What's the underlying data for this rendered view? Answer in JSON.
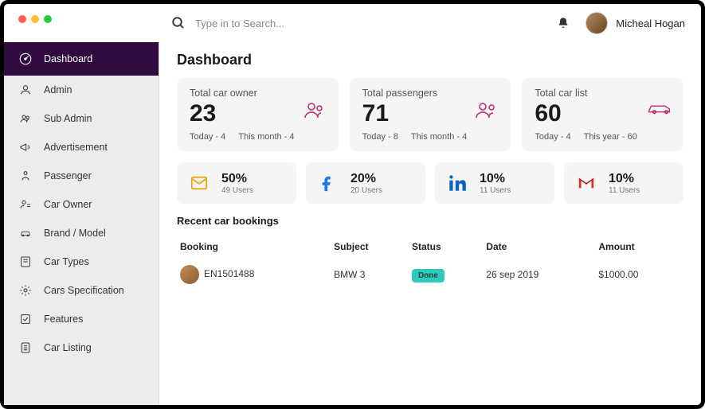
{
  "header": {
    "search_placeholder": "Type in to Search...",
    "username": "Micheal Hogan"
  },
  "sidebar": {
    "items": [
      {
        "label": "Dashboard",
        "icon": "dashboard-icon",
        "active": true
      },
      {
        "label": "Admin",
        "icon": "user-icon"
      },
      {
        "label": "Sub Admin",
        "icon": "users-icon"
      },
      {
        "label": "Advertisement",
        "icon": "megaphone-icon"
      },
      {
        "label": "Passenger",
        "icon": "passenger-icon"
      },
      {
        "label": "Car Owner",
        "icon": "owner-icon"
      },
      {
        "label": "Brand / Model",
        "icon": "car-brand-icon"
      },
      {
        "label": "Car Types",
        "icon": "cartype-icon"
      },
      {
        "label": "Cars Specification",
        "icon": "spec-icon"
      },
      {
        "label": "Features",
        "icon": "features-icon"
      },
      {
        "label": "Car Listing",
        "icon": "listing-icon"
      }
    ]
  },
  "page": {
    "title": "Dashboard"
  },
  "stats": [
    {
      "label": "Total car owner",
      "value": "23",
      "sub1": "Today - 4",
      "sub2": "This month  -  4",
      "icon": "owner"
    },
    {
      "label": "Total passengers",
      "value": "71",
      "sub1": "Today - 8",
      "sub2": "This month  -  4",
      "icon": "passenger"
    },
    {
      "label": "Total car list",
      "value": "60",
      "sub1": "Today - 4",
      "sub2": "This year  -  60",
      "icon": "car"
    }
  ],
  "socials": [
    {
      "pct": "50%",
      "users": "49 Users",
      "icon": "mail",
      "color": "#e6a817"
    },
    {
      "pct": "20%",
      "users": "20 Users",
      "icon": "facebook",
      "color": "#1877f2"
    },
    {
      "pct": "10%",
      "users": "11 Users",
      "icon": "linkedin",
      "color": "#0a66c2"
    },
    {
      "pct": "10%",
      "users": "11 Users",
      "icon": "gmail",
      "color": "#d93025"
    }
  ],
  "bookings": {
    "title": "Recent car bookings",
    "cols": [
      "Booking",
      "Subject",
      "Status",
      "Date",
      "Amount"
    ],
    "rows": [
      {
        "booking": "EN1501488",
        "subject": "BMW 3",
        "status": "Done",
        "date": "26 sep 2019",
        "amount": "$1000.00"
      }
    ]
  }
}
